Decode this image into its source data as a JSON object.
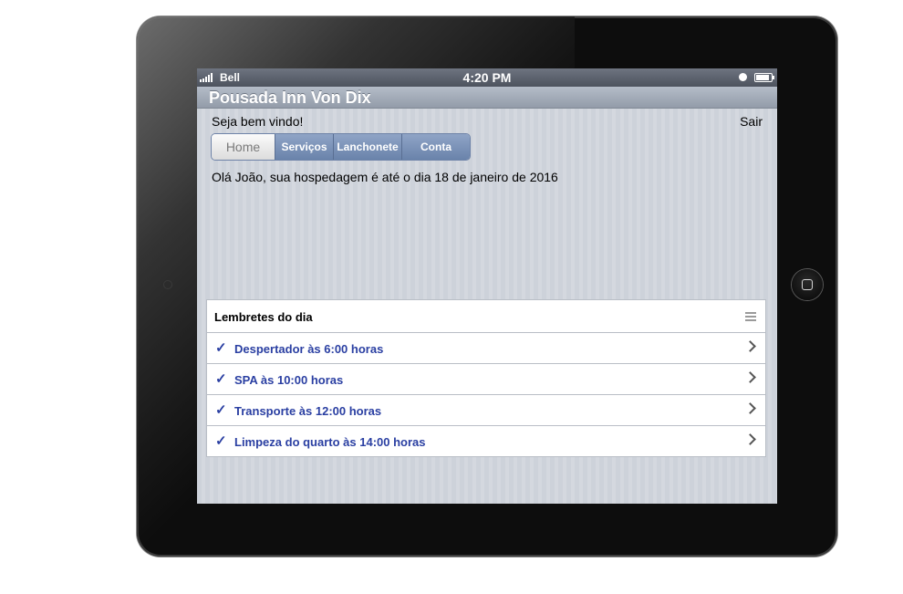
{
  "statusbar": {
    "carrier": "Bell",
    "time": "4:20 PM"
  },
  "app": {
    "title": "Pousada Inn Von Dix"
  },
  "header": {
    "welcome": "Seja bem vindo!",
    "logout": "Sair"
  },
  "tabs": [
    {
      "label": "Home",
      "active": true
    },
    {
      "label": "Serviços",
      "active": false
    },
    {
      "label": "Lanchonete",
      "active": false
    },
    {
      "label": "Conta",
      "active": false
    }
  ],
  "main": {
    "message": "Olá João, sua hospedagem é até o dia 18 de janeiro de 2016"
  },
  "reminders": {
    "title": "Lembretes do dia",
    "items": [
      {
        "label": "Despertador às 6:00 horas"
      },
      {
        "label": "SPA às 10:00 horas"
      },
      {
        "label": "Transporte às 12:00 horas"
      },
      {
        "label": "Limpeza do quarto às 14:00 horas"
      }
    ]
  },
  "colors": {
    "accent": "#2a3fa2",
    "tab_bar": "#7d93b8"
  }
}
